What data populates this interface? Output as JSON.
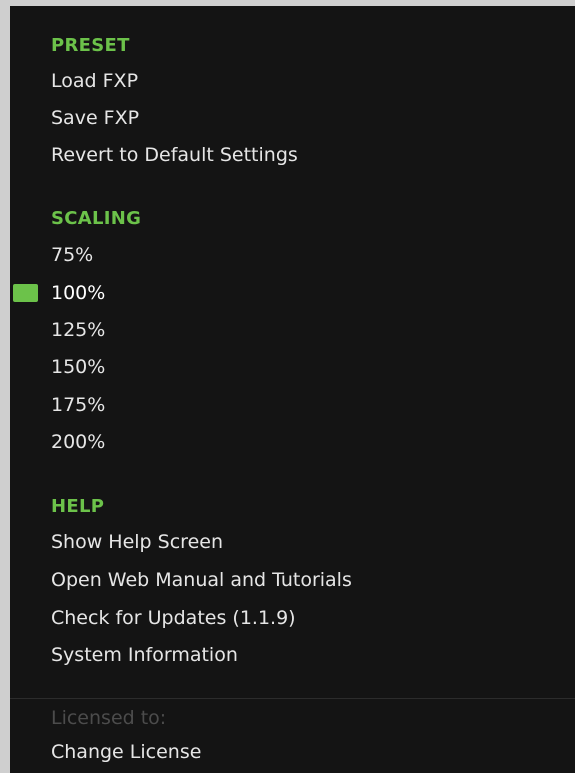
{
  "preset": {
    "header": "PRESET",
    "items": [
      "Load FXP",
      "Save FXP",
      "Revert to Default Settings"
    ]
  },
  "scaling": {
    "header": "SCALING",
    "items": [
      "75%",
      "100%",
      "125%",
      "150%",
      "175%",
      "200%"
    ],
    "selected": "100%"
  },
  "help": {
    "header": "HELP",
    "items": [
      "Show Help Screen",
      "Open Web Manual and Tutorials",
      "Check for Updates (1.1.9)",
      "System Information"
    ]
  },
  "license": {
    "licensed_to_label": "Licensed to:",
    "change_license_label": "Change License"
  },
  "colors": {
    "accent": "#6cc24a",
    "background": "#141414",
    "text": "#e6e6e6",
    "disabled_text": "#4c4c4c"
  }
}
